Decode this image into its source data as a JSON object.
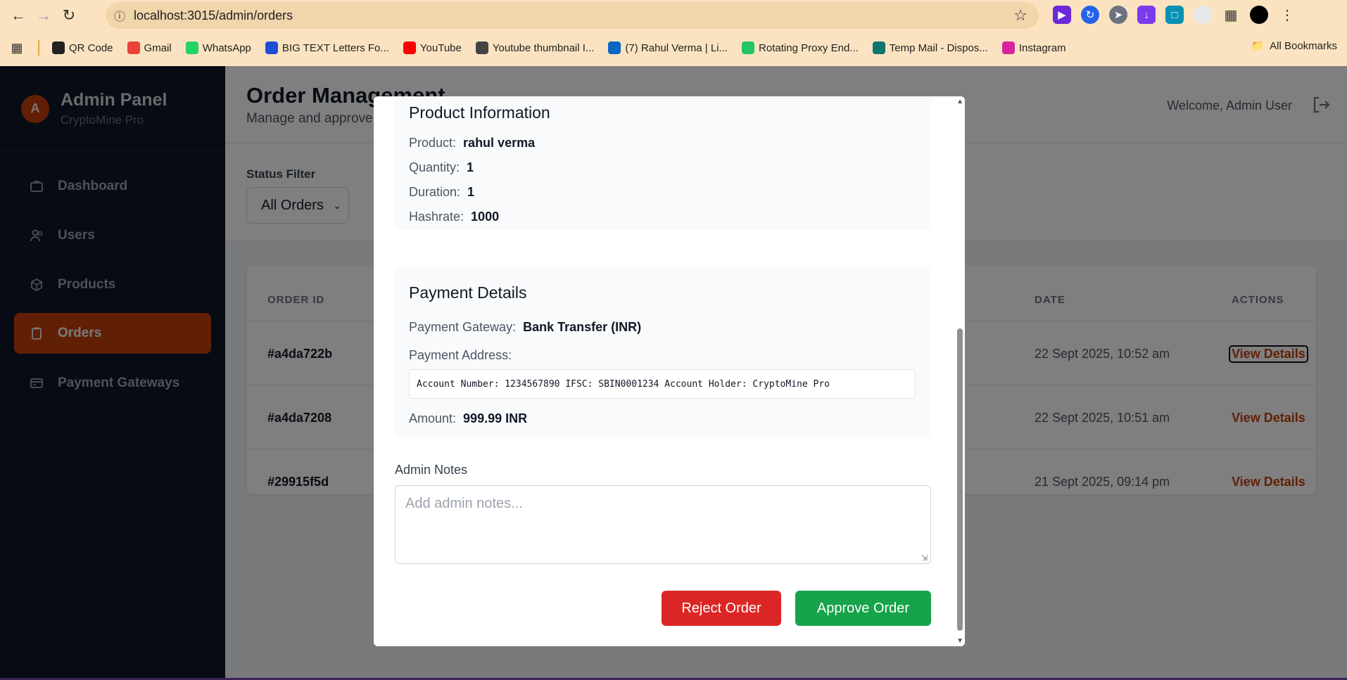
{
  "browser": {
    "url": "localhost:3015/admin/orders",
    "bookmarks": [
      {
        "label": "QR Code",
        "icon": "qr-icon",
        "color": "#222222"
      },
      {
        "label": "Gmail",
        "icon": "gmail-icon",
        "color": "#ea4335"
      },
      {
        "label": "WhatsApp",
        "icon": "whatsapp-icon",
        "color": "#25d366"
      },
      {
        "label": "BIG TEXT Letters Fo...",
        "icon": "heart-icon",
        "color": "#1d4ed8"
      },
      {
        "label": "YouTube",
        "icon": "youtube-icon",
        "color": "#ff0000"
      },
      {
        "label": "Youtube thumbnail I...",
        "icon": "thumbnail-icon",
        "color": "#444444"
      },
      {
        "label": "(7) Rahul Verma | Li...",
        "icon": "linkedin-icon",
        "color": "#0a66c2"
      },
      {
        "label": "Rotating Proxy End...",
        "icon": "proxy-icon",
        "color": "#22c55e"
      },
      {
        "label": "Temp Mail - Dispos...",
        "icon": "tempmail-icon",
        "color": "#0f766e"
      },
      {
        "label": "Instagram",
        "icon": "instagram-icon",
        "color": "#d6249f"
      }
    ],
    "all_bookmarks": "All Bookmarks"
  },
  "sidebar": {
    "avatar_letter": "A",
    "title": "Admin Panel",
    "subtitle": "CryptoMine Pro",
    "items": [
      {
        "label": "Dashboard",
        "icon": "dashboard-icon"
      },
      {
        "label": "Users",
        "icon": "users-icon"
      },
      {
        "label": "Products",
        "icon": "box-icon"
      },
      {
        "label": "Orders",
        "icon": "clipboard-icon",
        "active": true
      },
      {
        "label": "Payment Gateways",
        "icon": "card-icon"
      }
    ]
  },
  "header": {
    "title": "Order Management",
    "subtitle": "Manage and approve orders",
    "welcome": "Welcome, Admin User"
  },
  "filter": {
    "label": "Status Filter",
    "selected": "All Orders"
  },
  "table": {
    "headers": {
      "order_id": "ORDER ID",
      "date": "DATE",
      "actions": "ACTIONS"
    },
    "rows": [
      {
        "id": "#a4da722b",
        "date": "22 Sept 2025, 10:52 am",
        "action": "View Details"
      },
      {
        "id": "#a4da7208",
        "date": "22 Sept 2025, 10:51 am",
        "action": "View Details"
      },
      {
        "id": "#29915f5d",
        "date": "21 Sept 2025, 09:14 pm",
        "action": "View Details"
      }
    ]
  },
  "modal": {
    "product": {
      "title": "Product Information",
      "product_label": "Product:",
      "product_value": "rahul verma",
      "quantity_label": "Quantity:",
      "quantity_value": "1",
      "duration_label": "Duration:",
      "duration_value": "1",
      "hashrate_label": "Hashrate:",
      "hashrate_value": "1000"
    },
    "payment": {
      "title": "Payment Details",
      "gateway_label": "Payment Gateway:",
      "gateway_value": "Bank Transfer (INR)",
      "address_label": "Payment Address:",
      "address_value": "Account Number: 1234567890 IFSC: SBIN0001234 Account Holder: CryptoMine Pro",
      "amount_label": "Amount:",
      "amount_value": "999.99 INR"
    },
    "notes_label": "Admin Notes",
    "notes_placeholder": "Add admin notes...",
    "reject_label": "Reject Order",
    "approve_label": "Approve Order"
  }
}
